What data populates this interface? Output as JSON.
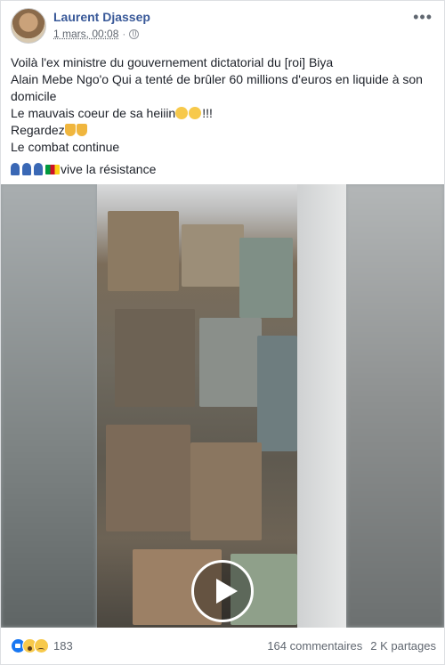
{
  "post": {
    "author": "Laurent Djassep",
    "date": "1 mars, 00:08",
    "privacy_icon": "globe-icon",
    "more_label": "•••",
    "lines": [
      "Voilà l'ex ministre du gouvernement dictatorial du [roi] Biya",
      "Alain Mebe Ngo'o Qui a tenté de brûler 60 millions d'euros en liquide à son",
      "domicile",
      "Le mauvais coeur de sa heiiin",
      "!!!",
      "Regardez",
      "Le combat continue",
      "vive la résistance"
    ]
  },
  "video": {
    "play_icon": "play-icon"
  },
  "footer": {
    "reactions": [
      "like-icon",
      "wow-icon",
      "sad-icon"
    ],
    "reaction_count": "183",
    "comments": "164 commentaires",
    "shares": "2 K partages"
  },
  "colors": {
    "author": "#385898",
    "accent": "#1877f2"
  }
}
